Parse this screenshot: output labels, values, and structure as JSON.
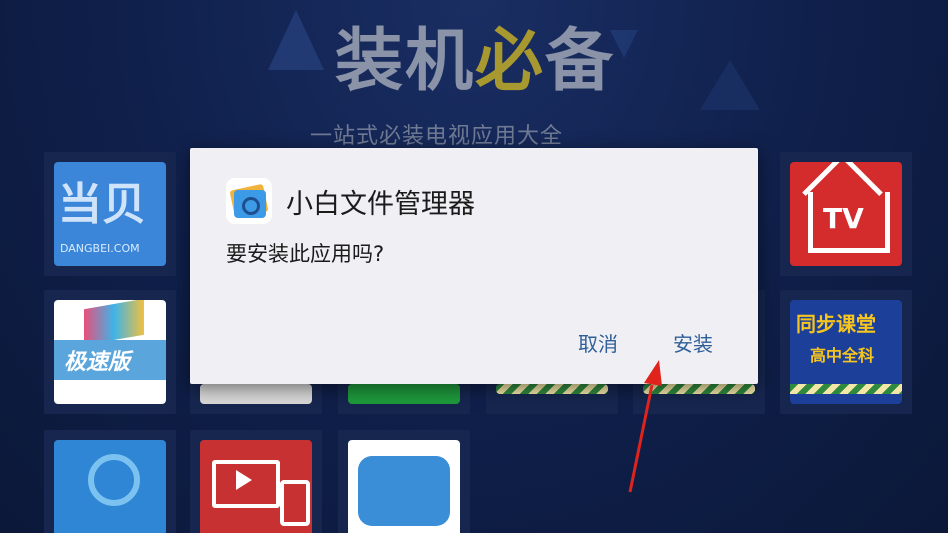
{
  "background": {
    "hero_title_main": "装机",
    "hero_title_accent": "必",
    "hero_title_end": "备",
    "hero_subtitle": "一站式必装电视应用大全",
    "tiles": {
      "dangbei_label": "当贝",
      "dangbei_url": "DANGBEI.COM",
      "jisu_label": "极速版",
      "tv_label": "TV",
      "tongbuke_label": "同步课堂",
      "gaozhong_label": "高中全科"
    }
  },
  "dialog": {
    "app_name": "小白文件管理器",
    "question": "要安装此应用吗?",
    "cancel_label": "取消",
    "install_label": "安装"
  },
  "colors": {
    "dialog_bg": "#f0f0f4",
    "button_text": "#2f5f98",
    "annotation_arrow": "#e0231c"
  }
}
